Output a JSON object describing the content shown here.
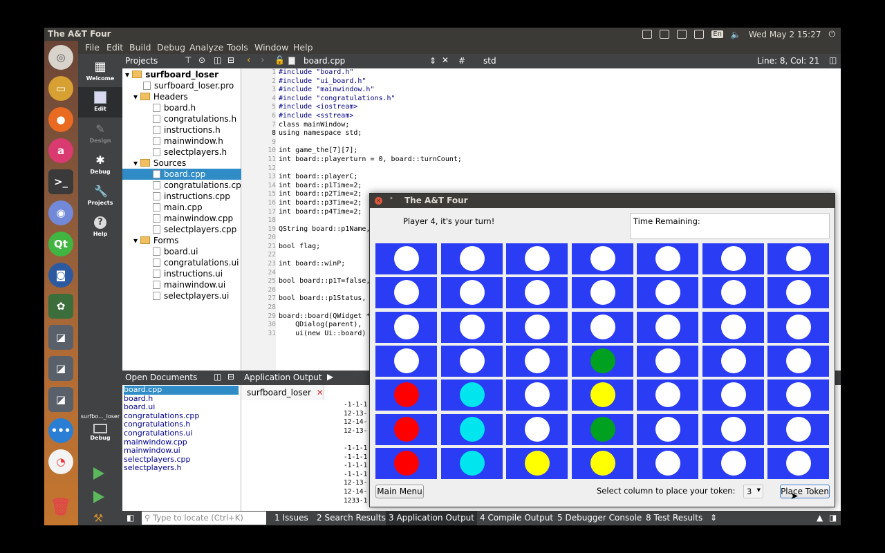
{
  "window_title": "The A&T Four",
  "tray": {
    "keyboard": "En",
    "datetime": "Wed May 2 15:27"
  },
  "menu": [
    "File",
    "Edit",
    "Build",
    "Debug",
    "Analyze",
    "Tools",
    "Window",
    "Help"
  ],
  "modes": [
    "Welcome",
    "Edit",
    "Design",
    "Debug",
    "Projects",
    "Help"
  ],
  "run_target": "surfbo..._loser",
  "run_target_mode": "Debug",
  "projects_panel": {
    "title": "Projects",
    "project": "surfboard_loser",
    "pro_file": "surfboard_loser.pro",
    "headers_label": "Headers",
    "headers": [
      "board.h",
      "congratulations.h",
      "instructions.h",
      "mainwindow.h",
      "selectplayers.h"
    ],
    "sources_label": "Sources",
    "sources": [
      "board.cpp",
      "congratulations.cpp",
      "instructions.cpp",
      "main.cpp",
      "mainwindow.cpp",
      "selectplayers.cpp"
    ],
    "forms_label": "Forms",
    "forms": [
      "board.ui",
      "congratulations.ui",
      "instructions.ui",
      "mainwindow.ui",
      "selectplayers.ui"
    ]
  },
  "editor": {
    "file": "board.cpp",
    "symbol": "std",
    "position": "Line: 8, Col: 21",
    "line_numbers": [
      "1",
      "2",
      "3",
      "4",
      "5",
      "6",
      "7",
      "8",
      "9",
      "10",
      "11",
      "12",
      "13",
      "14",
      "15",
      "16",
      "17",
      "18",
      "19",
      "20",
      "21",
      "22",
      "23",
      "24",
      "25",
      "26",
      "27",
      "28",
      "29",
      "30",
      "31"
    ],
    "lines": [
      "#include \"board.h\"",
      "#include \"ui_board.h\"",
      "#include \"mainwindow.h\"",
      "#include \"congratulations.h\"",
      "#include <iostream>",
      "#include <sstream>",
      "class mainWindow;",
      "using namespace std;",
      "",
      "int game_the[7][7];",
      "int board::playerturn = 0, board::turnCount;",
      "",
      "int board::playerC;",
      "int board::p1Time=2;",
      "int board::p2Time=2;",
      "int board::p3Time=2;",
      "int board::p4Time=2;",
      "",
      "QString board::p1Name,",
      "",
      "bool flag;",
      "",
      "int board::winP;",
      "",
      "bool board::p1T=false,",
      "",
      "bool board::p1Status,",
      "",
      "board::board(QWidget *",
      "    QDialog(parent),",
      "    ui(new Ui::board)"
    ]
  },
  "open_documents": {
    "title": "Open Documents",
    "items": [
      "board.cpp",
      "board.h",
      "board.ui",
      "congratulations.cpp",
      "congratulations.h",
      "congratulations.ui",
      "mainwindow.cpp",
      "mainwindow.ui",
      "selectplayers.cpp",
      "selectplayers.h"
    ]
  },
  "app_output": {
    "title": "Application Output",
    "tab": "surfboard_loser",
    "lines": [
      "-1-1-1",
      "12-13-",
      "12-14-",
      "12-13-",
      "",
      "-1-1-1",
      "-1-1-1",
      "-1-1-1",
      "-1-1-1",
      "12-13-",
      "12-14-",
      "1233-1"
    ]
  },
  "statusbar": {
    "locate_placeholder": "Type to locate (Ctrl+K)",
    "tabs": [
      "1  Issues",
      "2  Search Results",
      "3  Application Output",
      "4  Compile Output",
      "5  Debugger Console",
      "8  Test Results"
    ]
  },
  "game": {
    "title": "The A&T Four",
    "turn_label": "Player 4, it's your turn!",
    "time_label": "Time Remaining:",
    "main_menu": "Main Menu",
    "select_label": "Select column to place your token:",
    "column_value": "3",
    "place_button": "Place Token",
    "colors": {
      "empty": "#ffffff",
      "red": "#ff0000",
      "cyan": "#00e5ee",
      "yellow": "#ffff00",
      "green": "#00a020",
      "board": "#2b3cf5"
    },
    "grid": [
      [
        "empty",
        "empty",
        "empty",
        "empty",
        "empty",
        "empty",
        "empty"
      ],
      [
        "empty",
        "empty",
        "empty",
        "empty",
        "empty",
        "empty",
        "empty"
      ],
      [
        "empty",
        "empty",
        "empty",
        "empty",
        "empty",
        "empty",
        "empty"
      ],
      [
        "empty",
        "empty",
        "empty",
        "green",
        "empty",
        "empty",
        "empty"
      ],
      [
        "red",
        "cyan",
        "empty",
        "yellow",
        "empty",
        "empty",
        "empty"
      ],
      [
        "red",
        "cyan",
        "empty",
        "green",
        "empty",
        "empty",
        "empty"
      ],
      [
        "red",
        "cyan",
        "yellow",
        "yellow",
        "empty",
        "empty",
        "empty"
      ]
    ]
  }
}
